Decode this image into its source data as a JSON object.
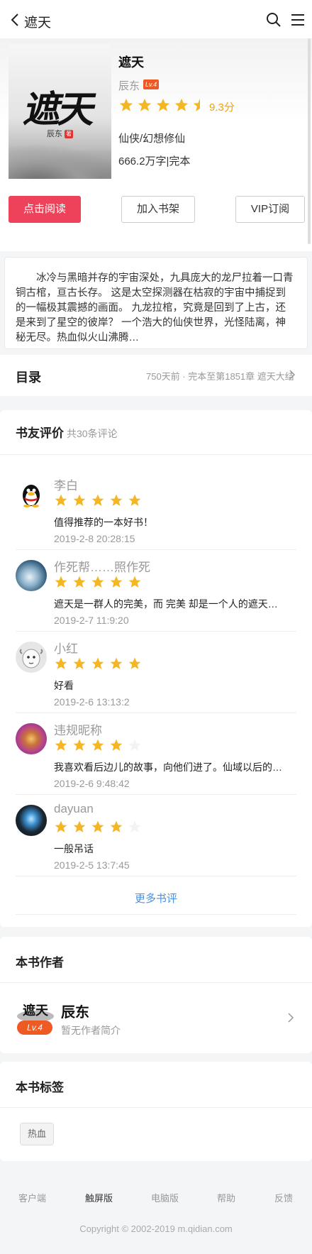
{
  "header": {
    "title": "遮天",
    "back_icon": "chevron-left-icon",
    "search_icon": "search-icon",
    "menu_icon": "hamburger-menu-icon"
  },
  "book": {
    "cover": {
      "title": "遮天",
      "author": "辰东",
      "seal": "著"
    },
    "name": "遮天",
    "author": "辰东",
    "level": "Lv.4",
    "rating": 4.5,
    "score": "9.3分",
    "genre": "仙侠/幻想修仙",
    "words": "666.2万字|完本",
    "buttons": {
      "read": "点击阅读",
      "shelf": "加入书架",
      "vip": "VIP订阅"
    },
    "colors": {
      "accent": "#ed4259",
      "star": "#f5b623"
    }
  },
  "intro": "冰冷与黑暗并存的宇宙深处，九具庞大的龙尸拉着一口青铜古棺，亘古长存。 这是太空探测器在枯寂的宇宙中捕捉到的一幅极其震撼的画面。 九龙拉棺，究竟是回到了上古，还是来到了星空的彼岸？ 一个浩大的仙侠世界，光怪陆离，神秘无尽。热血似火山沸腾…",
  "catalog": {
    "title": "目录",
    "info": "750天前 · 完本至第1851章 遮天大结局"
  },
  "reviews": {
    "title": "书友评价",
    "count": "共30条评论",
    "items": [
      {
        "name": "李白",
        "stars": 5,
        "text": "值得推荐的一本好书！",
        "time": "2019-2-8 20:28:15",
        "avatar": "penguin-avatar"
      },
      {
        "name": "作死帮……照作死",
        "stars": 5,
        "text": "遮天是一群人的完美，而 完美 却是一个人的遮天…",
        "time": "2019-2-7 11:9:20",
        "avatar": "waterfall-avatar"
      },
      {
        "name": "小红",
        "stars": 5,
        "text": "好看",
        "time": "2019-2-6 13:13:2",
        "avatar": "sheep-avatar"
      },
      {
        "name": "违规昵称",
        "stars": 4,
        "text": "我喜欢看后边儿的故事，向他们进了。仙域以后的…",
        "time": "2019-2-6 9:48:42",
        "avatar": "flower-avatar"
      },
      {
        "name": "dayuan",
        "stars": 4,
        "text": "一般吊话",
        "time": "2019-2-5 13:7:45",
        "avatar": "screen-avatar"
      }
    ],
    "more": "更多书评"
  },
  "author_section": {
    "title": "本书作者",
    "name": "辰东",
    "level": "Lv.4",
    "desc": "暂无作者简介"
  },
  "tags_section": {
    "title": "本书标签",
    "tags": [
      "热血"
    ]
  },
  "footer": {
    "links": [
      "客户端",
      "触屏版",
      "电脑版",
      "帮助",
      "反馈"
    ],
    "active": "触屏版",
    "copyright": "Copyright © 2002-2019 m.qidian.com"
  }
}
